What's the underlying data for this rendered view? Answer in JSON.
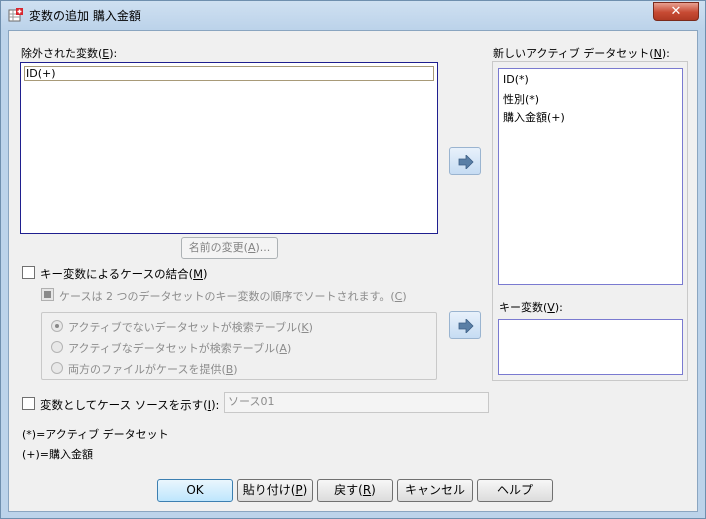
{
  "window": {
    "title": "変数の追加 購入金額",
    "close_glyph": "✕"
  },
  "excluded": {
    "label_pre": "除外された変数(",
    "label_key": "E",
    "label_post": "):",
    "items": [
      "ID(+)"
    ]
  },
  "rename_button": {
    "pre": "名前の変更(",
    "key": "A",
    "post": ")..."
  },
  "key_match": {
    "pre": "キー変数によるケースの結合(",
    "key": "M",
    "post": ")",
    "checked": false
  },
  "sorted_option": {
    "pre": "ケースは 2 つのデータセットのキー変数の順序でソートされます。(",
    "key": "C",
    "post": ")"
  },
  "radios": [
    {
      "pre": "アクティブでないデータセットが検索テーブル(",
      "key": "K",
      "post": ")",
      "selected": true
    },
    {
      "pre": "アクティブなデータセットが検索テーブル(",
      "key": "A",
      "post": ")",
      "selected": false
    },
    {
      "pre": "両方のファイルがケースを提供(",
      "key": "B",
      "post": ")",
      "selected": false
    }
  ],
  "source_indicator": {
    "pre": "変数としてケース ソースを示す(",
    "key": "I",
    "post": "):",
    "value": "ソース01",
    "checked": false
  },
  "legend": {
    "active": "(*)=アクティブ データセット",
    "other": "(+)=購入金額"
  },
  "new_dataset": {
    "label_pre": "新しいアクティブ データセット(",
    "label_key": "N",
    "label_post": "):",
    "items": [
      "ID(*)",
      "性別(*)",
      "購入金額(+)"
    ]
  },
  "key_variables": {
    "label_pre": "キー変数(",
    "label_key": "V",
    "label_post": "):"
  },
  "buttons": {
    "ok": "OK",
    "paste_pre": "貼り付け(",
    "paste_key": "P",
    "paste_post": ")",
    "reset_pre": "戻す(",
    "reset_key": "R",
    "reset_post": ")",
    "cancel": "キャンセル",
    "help": "ヘルプ"
  },
  "colors": {
    "frame": "#bcd3ea",
    "close": "#c74a33",
    "list_border": "#1f1f8f",
    "default_button": "#bee6fd"
  },
  "icons": {
    "app": "spss-add-variables-icon",
    "move": "arrow-right-icon"
  }
}
